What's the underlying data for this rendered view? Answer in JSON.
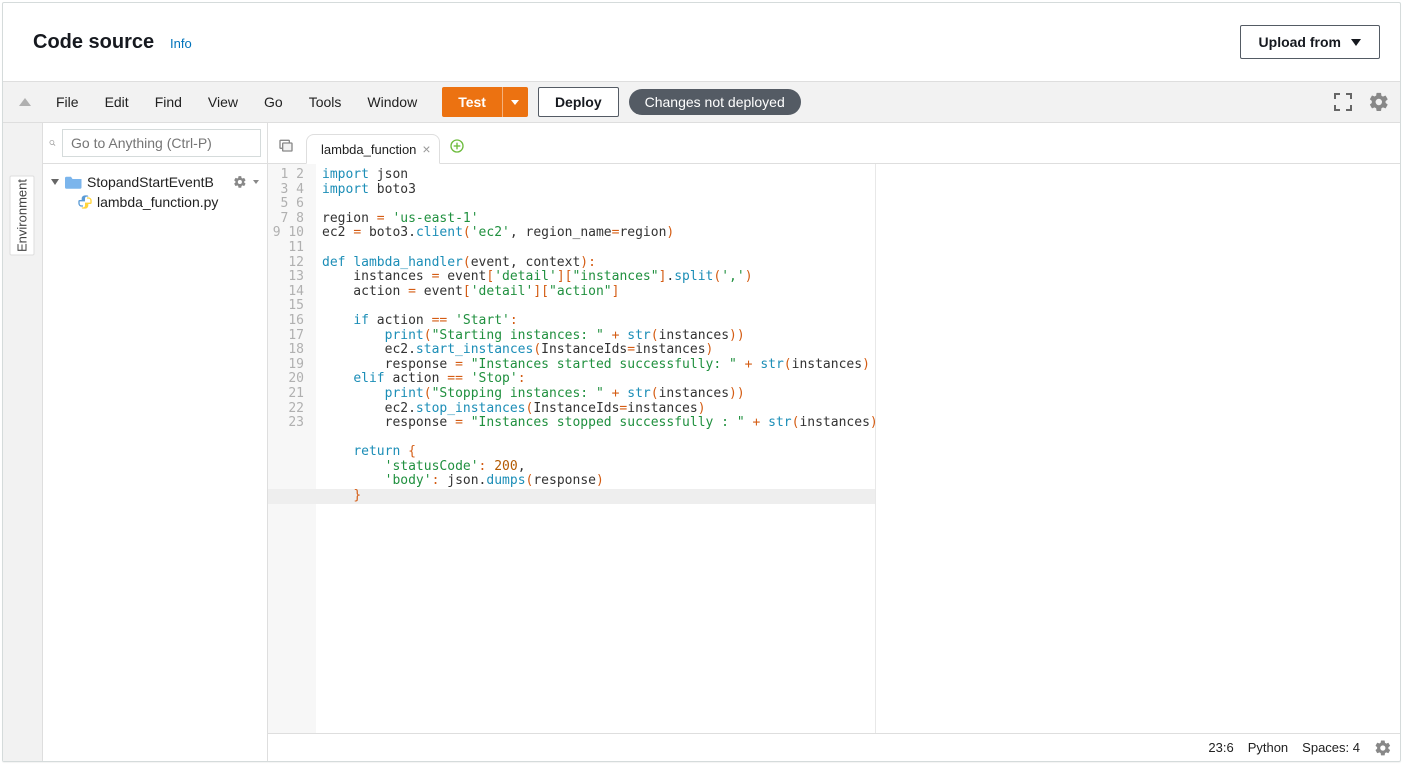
{
  "panel": {
    "title": "Code source",
    "info": "Info",
    "upload": "Upload from"
  },
  "menubar": {
    "items": [
      "File",
      "Edit",
      "Find",
      "View",
      "Go",
      "Tools",
      "Window"
    ],
    "test": "Test",
    "deploy": "Deploy",
    "status": "Changes not deployed"
  },
  "sidebar": {
    "env_label": "Environment",
    "goto_placeholder": "Go to Anything (Ctrl-P)",
    "root": "StopandStartEventB",
    "file": "lambda_function.py"
  },
  "tabs": {
    "active": "lambda_function"
  },
  "code": {
    "line_count": 23,
    "highlight_line": 23,
    "lines": [
      [
        [
          "kw",
          "import"
        ],
        [
          "",
          " json"
        ]
      ],
      [
        [
          "kw",
          "import"
        ],
        [
          "",
          " boto3"
        ]
      ],
      [
        [
          "",
          ""
        ]
      ],
      [
        [
          "",
          "region "
        ],
        [
          "op",
          "="
        ],
        [
          "",
          " "
        ],
        [
          "str",
          "'us-east-1'"
        ]
      ],
      [
        [
          "",
          "ec2 "
        ],
        [
          "op",
          "="
        ],
        [
          "",
          " boto3."
        ],
        [
          "fn",
          "client"
        ],
        [
          "br",
          "("
        ],
        [
          "str",
          "'ec2'"
        ],
        [
          "",
          ", region_name"
        ],
        [
          "op",
          "="
        ],
        [
          "",
          "region"
        ],
        [
          "br",
          ")"
        ]
      ],
      [
        [
          "",
          ""
        ]
      ],
      [
        [
          "kw",
          "def"
        ],
        [
          "",
          " "
        ],
        [
          "fn",
          "lambda_handler"
        ],
        [
          "br",
          "("
        ],
        [
          "",
          "event, context"
        ],
        [
          "br",
          ")"
        ],
        [
          "op",
          ":"
        ]
      ],
      [
        [
          "",
          "    instances "
        ],
        [
          "op",
          "="
        ],
        [
          "",
          " event"
        ],
        [
          "br",
          "["
        ],
        [
          "str",
          "'detail'"
        ],
        [
          "br",
          "]"
        ],
        [
          "br",
          "["
        ],
        [
          "str",
          "\"instances\""
        ],
        [
          "br",
          "]"
        ],
        [
          "",
          "."
        ],
        [
          "fn",
          "split"
        ],
        [
          "br",
          "("
        ],
        [
          "str",
          "','"
        ],
        [
          "br",
          ")"
        ]
      ],
      [
        [
          "",
          "    action "
        ],
        [
          "op",
          "="
        ],
        [
          "",
          " event"
        ],
        [
          "br",
          "["
        ],
        [
          "str",
          "'detail'"
        ],
        [
          "br",
          "]"
        ],
        [
          "br",
          "["
        ],
        [
          "str",
          "\"action\""
        ],
        [
          "br",
          "]"
        ]
      ],
      [
        [
          "",
          ""
        ]
      ],
      [
        [
          "",
          "    "
        ],
        [
          "kw",
          "if"
        ],
        [
          "",
          " action "
        ],
        [
          "op",
          "=="
        ],
        [
          "",
          " "
        ],
        [
          "str",
          "'Start'"
        ],
        [
          "op",
          ":"
        ]
      ],
      [
        [
          "",
          "        "
        ],
        [
          "bi",
          "print"
        ],
        [
          "br",
          "("
        ],
        [
          "str",
          "\"Starting instances: \""
        ],
        [
          "",
          " "
        ],
        [
          "op",
          "+"
        ],
        [
          "",
          " "
        ],
        [
          "bi",
          "str"
        ],
        [
          "br",
          "("
        ],
        [
          "",
          "instances"
        ],
        [
          "br",
          "))"
        ]
      ],
      [
        [
          "",
          "        ec2."
        ],
        [
          "fn",
          "start_instances"
        ],
        [
          "br",
          "("
        ],
        [
          "",
          "InstanceIds"
        ],
        [
          "op",
          "="
        ],
        [
          "",
          "instances"
        ],
        [
          "br",
          ")"
        ]
      ],
      [
        [
          "",
          "        response "
        ],
        [
          "op",
          "="
        ],
        [
          "",
          " "
        ],
        [
          "str",
          "\"Instances started successfully: \""
        ],
        [
          "",
          " "
        ],
        [
          "op",
          "+"
        ],
        [
          "",
          " "
        ],
        [
          "bi",
          "str"
        ],
        [
          "br",
          "("
        ],
        [
          "",
          "instances"
        ],
        [
          "br",
          ")"
        ]
      ],
      [
        [
          "",
          "    "
        ],
        [
          "kw",
          "elif"
        ],
        [
          "",
          " action "
        ],
        [
          "op",
          "=="
        ],
        [
          "",
          " "
        ],
        [
          "str",
          "'Stop'"
        ],
        [
          "op",
          ":"
        ]
      ],
      [
        [
          "",
          "        "
        ],
        [
          "bi",
          "print"
        ],
        [
          "br",
          "("
        ],
        [
          "str",
          "\"Stopping instances: \""
        ],
        [
          "",
          " "
        ],
        [
          "op",
          "+"
        ],
        [
          "",
          " "
        ],
        [
          "bi",
          "str"
        ],
        [
          "br",
          "("
        ],
        [
          "",
          "instances"
        ],
        [
          "br",
          "))"
        ]
      ],
      [
        [
          "",
          "        ec2."
        ],
        [
          "fn",
          "stop_instances"
        ],
        [
          "br",
          "("
        ],
        [
          "",
          "InstanceIds"
        ],
        [
          "op",
          "="
        ],
        [
          "",
          "instances"
        ],
        [
          "br",
          ")"
        ]
      ],
      [
        [
          "",
          "        response "
        ],
        [
          "op",
          "="
        ],
        [
          "",
          " "
        ],
        [
          "str",
          "\"Instances stopped successfully : \""
        ],
        [
          "",
          " "
        ],
        [
          "op",
          "+"
        ],
        [
          "",
          " "
        ],
        [
          "bi",
          "str"
        ],
        [
          "br",
          "("
        ],
        [
          "",
          "instances"
        ],
        [
          "br",
          ")"
        ]
      ],
      [
        [
          "",
          ""
        ]
      ],
      [
        [
          "",
          "    "
        ],
        [
          "kw",
          "return"
        ],
        [
          "",
          " "
        ],
        [
          "br",
          "{"
        ]
      ],
      [
        [
          "",
          "        "
        ],
        [
          "str",
          "'statusCode'"
        ],
        [
          "op",
          ":"
        ],
        [
          "",
          " "
        ],
        [
          "num",
          "200"
        ],
        [
          "",
          ","
        ]
      ],
      [
        [
          "",
          "        "
        ],
        [
          "str",
          "'body'"
        ],
        [
          "op",
          ":"
        ],
        [
          "",
          " json."
        ],
        [
          "fn",
          "dumps"
        ],
        [
          "br",
          "("
        ],
        [
          "",
          "response"
        ],
        [
          "br",
          ")"
        ]
      ],
      [
        [
          "",
          "    "
        ],
        [
          "br",
          "}"
        ]
      ]
    ]
  },
  "status": {
    "pos": "23:6",
    "lang": "Python",
    "spaces": "Spaces: 4"
  }
}
